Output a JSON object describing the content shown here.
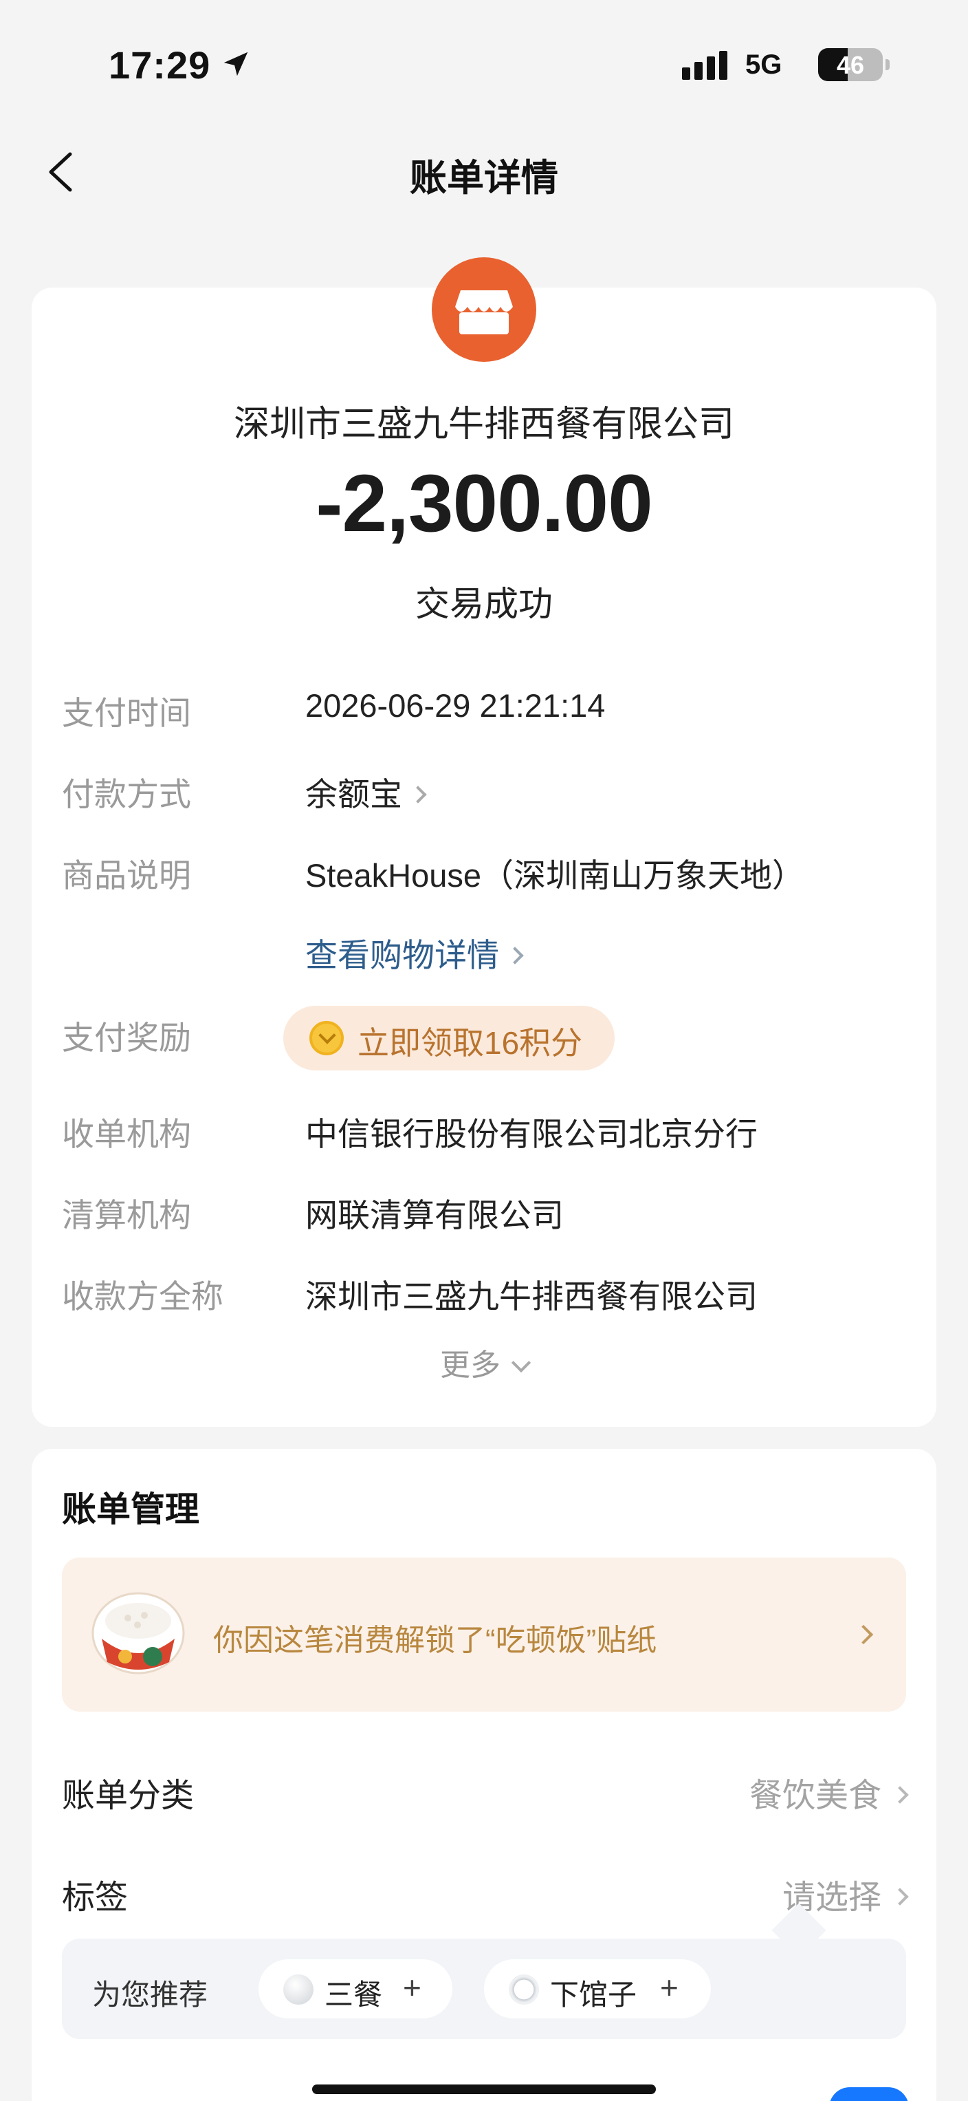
{
  "status_bar": {
    "time": "17:29",
    "network": "5G",
    "battery": "46"
  },
  "header": {
    "title": "账单详情"
  },
  "merchant": {
    "name": "深圳市三盛九牛排西餐有限公司",
    "amount": "-2,300.00",
    "status": "交易成功"
  },
  "details": {
    "pay_time": {
      "label": "支付时间",
      "value": "2026-06-29 21:21:14"
    },
    "pay_method": {
      "label": "付款方式",
      "value": "余额宝"
    },
    "product": {
      "label": "商品说明",
      "value": "SteakHouse（深圳南山万象天地）",
      "link": "查看购物详情"
    },
    "reward": {
      "label": "支付奖励",
      "value": "立即领取16积分"
    },
    "acquirer": {
      "label": "收单机构",
      "value": "中信银行股份有限公司北京分行"
    },
    "clearing": {
      "label": "清算机构",
      "value": "网联清算有限公司"
    },
    "payee": {
      "label": "收款方全称",
      "value": "深圳市三盛九牛排西餐有限公司"
    },
    "more": "更多"
  },
  "manage": {
    "title": "账单管理",
    "sticker_text": "你因这笔消费解锁了“吃顿饭”贴纸",
    "category": {
      "label": "账单分类",
      "value": "餐饮美食"
    },
    "tag": {
      "label": "标签",
      "value": "请选择"
    },
    "recommend": {
      "label": "为您推荐",
      "chips": [
        "三餐",
        "下馆子"
      ]
    }
  },
  "colors": {
    "merchant_logo": "#e9612f",
    "link": "#2e5d8c",
    "reward": "#b8732e",
    "toggle": "#1677ff"
  }
}
